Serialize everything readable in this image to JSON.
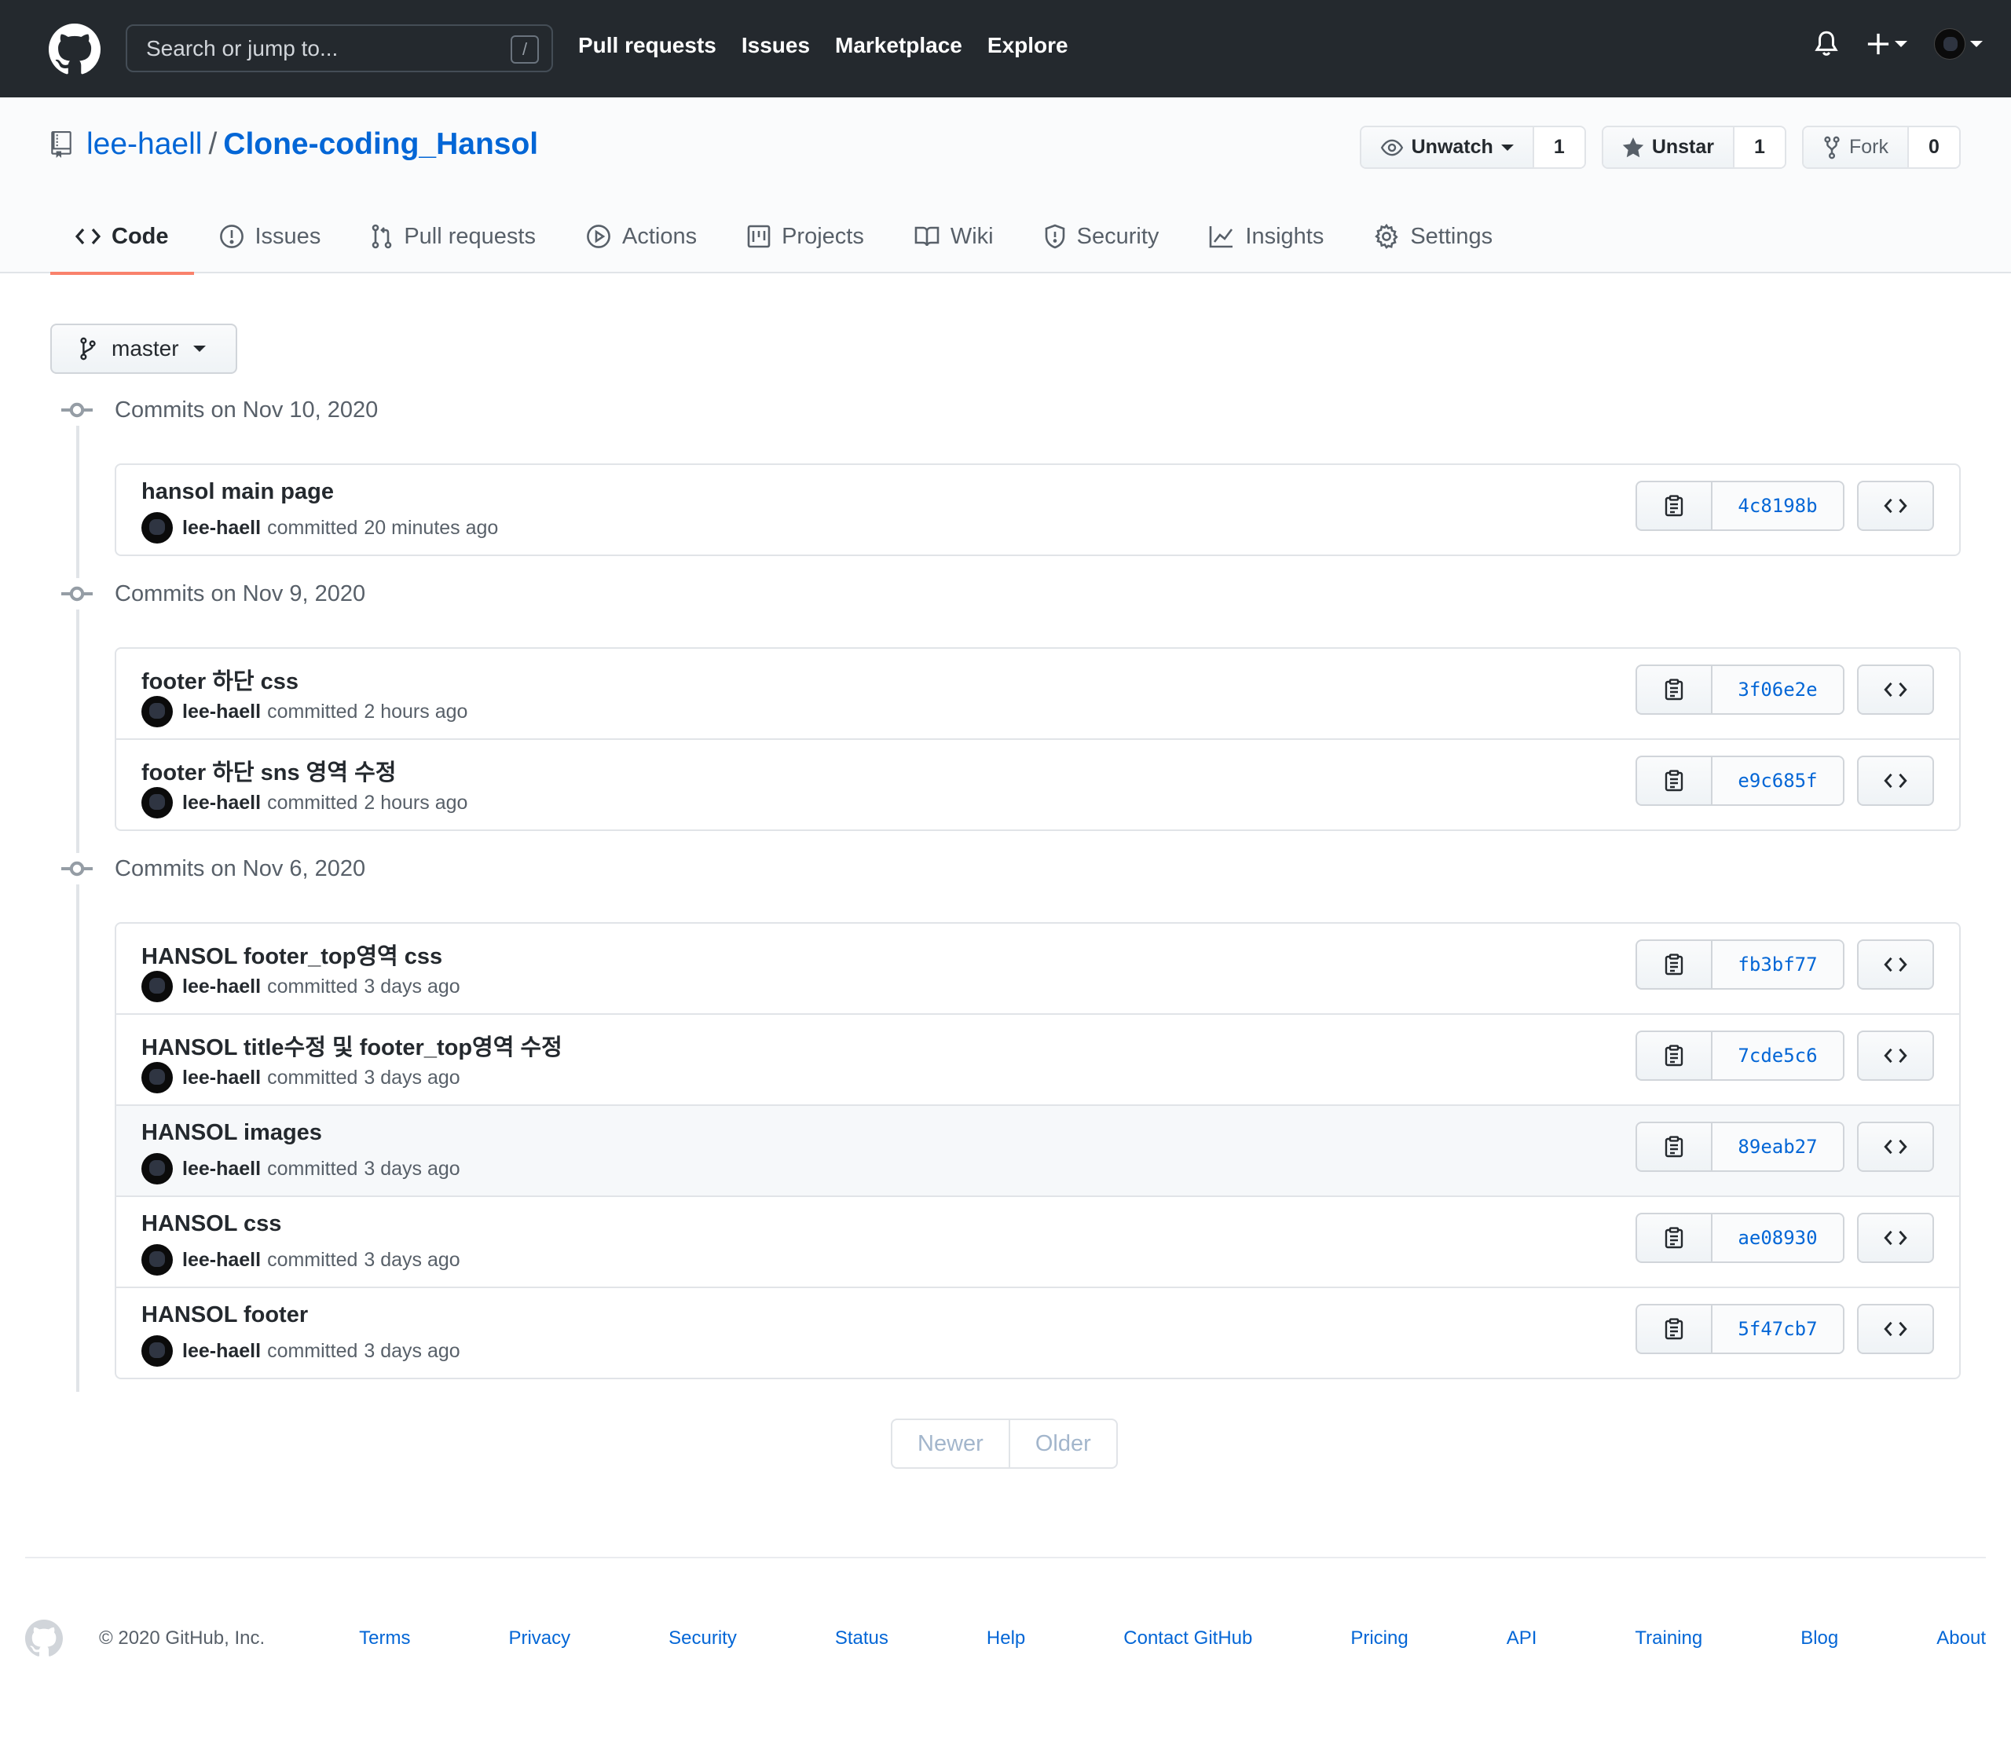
{
  "header": {
    "search_placeholder": "Search or jump to...",
    "slash_key": "/",
    "nav": [
      "Pull requests",
      "Issues",
      "Marketplace",
      "Explore"
    ]
  },
  "repo": {
    "owner": "lee-haell",
    "separator": "/",
    "name": "Clone-coding_Hansol",
    "watch_label": "Unwatch",
    "watch_count": "1",
    "star_label": "Unstar",
    "star_count": "1",
    "fork_label": "Fork",
    "fork_count": "0"
  },
  "tabs": [
    {
      "label": "Code",
      "icon": "code-icon"
    },
    {
      "label": "Issues",
      "icon": "issue-opened-icon"
    },
    {
      "label": "Pull requests",
      "icon": "git-pull-request-icon"
    },
    {
      "label": "Actions",
      "icon": "play-icon"
    },
    {
      "label": "Projects",
      "icon": "project-icon"
    },
    {
      "label": "Wiki",
      "icon": "book-icon"
    },
    {
      "label": "Security",
      "icon": "shield-icon"
    },
    {
      "label": "Insights",
      "icon": "graph-icon"
    },
    {
      "label": "Settings",
      "icon": "gear-icon"
    }
  ],
  "branch": "master",
  "commit_groups": [
    {
      "title": "Commits on Nov 10, 2020",
      "commits": [
        {
          "message": "hansol main page",
          "author": "lee-haell",
          "verb": "committed",
          "time": "20 minutes ago",
          "sha": "4c8198b"
        }
      ]
    },
    {
      "title": "Commits on Nov 9, 2020",
      "commits": [
        {
          "message": "footer 하단 css",
          "author": "lee-haell",
          "verb": "committed",
          "time": "2 hours ago",
          "sha": "3f06e2e"
        },
        {
          "message": "footer 하단 sns 영역 수정",
          "author": "lee-haell",
          "verb": "committed",
          "time": "2 hours ago",
          "sha": "e9c685f"
        }
      ]
    },
    {
      "title": "Commits on Nov 6, 2020",
      "commits": [
        {
          "message": "HANSOL footer_top영역 css",
          "author": "lee-haell",
          "verb": "committed",
          "time": "3 days ago",
          "sha": "fb3bf77"
        },
        {
          "message": "HANSOL title수정 및 footer_top영역 수정",
          "author": "lee-haell",
          "verb": "committed",
          "time": "3 days ago",
          "sha": "7cde5c6"
        },
        {
          "message": "HANSOL images",
          "author": "lee-haell",
          "verb": "committed",
          "time": "3 days ago",
          "sha": "89eab27"
        },
        {
          "message": "HANSOL css",
          "author": "lee-haell",
          "verb": "committed",
          "time": "3 days ago",
          "sha": "ae08930"
        },
        {
          "message": "HANSOL footer",
          "author": "lee-haell",
          "verb": "committed",
          "time": "3 days ago",
          "sha": "5f47cb7"
        }
      ]
    }
  ],
  "pagination": {
    "newer": "Newer",
    "older": "Older"
  },
  "footer": {
    "copyright": "© 2020 GitHub, Inc.",
    "links": [
      "Terms",
      "Privacy",
      "Security",
      "Status",
      "Help",
      "Contact GitHub",
      "Pricing",
      "API",
      "Training",
      "Blog",
      "About"
    ]
  },
  "colors": {
    "header_bg": "#24292e",
    "link": "#0366d6",
    "tab_underline": "#f9826c",
    "muted_text": "#586069"
  }
}
